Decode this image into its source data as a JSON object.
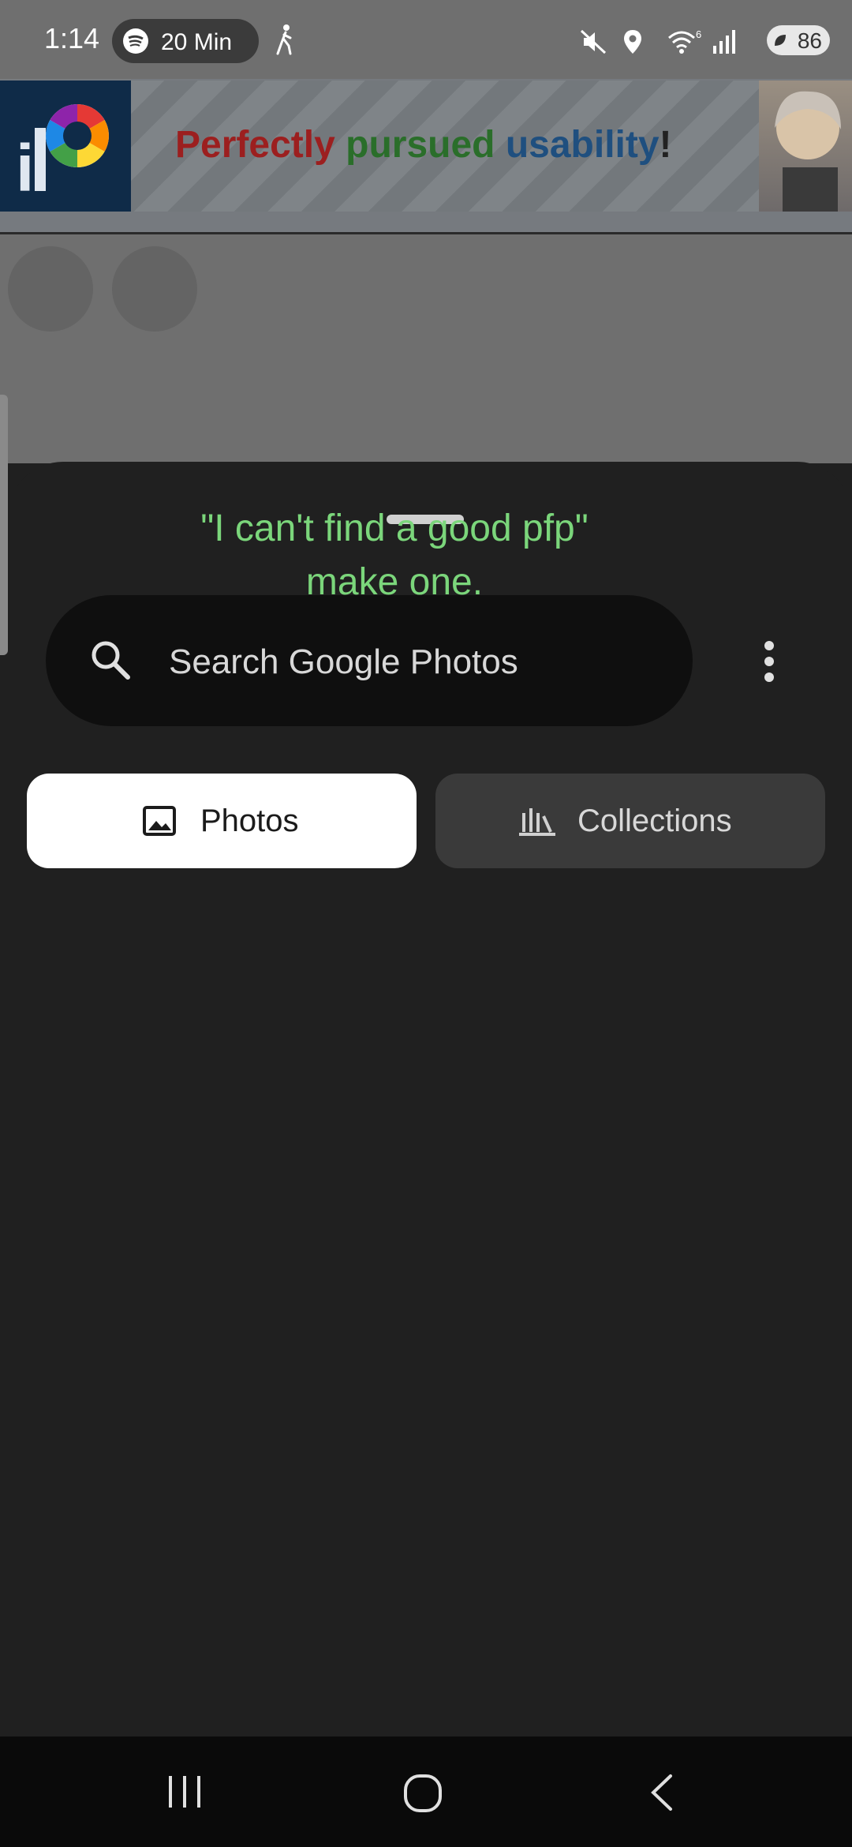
{
  "status_bar": {
    "time": "1:14",
    "spotify_label": "20 Min",
    "battery": "86",
    "icons": [
      "spotify-icon",
      "walk-icon",
      "mute-icon",
      "location-icon",
      "wifi-icon",
      "signal-icon",
      "battery-icon"
    ]
  },
  "ad": {
    "word1": "Perfectly",
    "word2": "pursued",
    "word3": "usability",
    "word4": "!",
    "colors": {
      "word1": "#9c1f1f",
      "word2": "#2a6e2a",
      "word3": "#1f4f7f"
    }
  },
  "sheet": {
    "caption_line1": "\"I can't find a good pfp\"",
    "caption_line2": "make one.",
    "search_placeholder": "Search Google Photos",
    "tabs": [
      {
        "label": "Photos",
        "selected": true,
        "icon": "image-icon"
      },
      {
        "label": "Collections",
        "selected": false,
        "icon": "collections-icon"
      }
    ]
  },
  "nav": {
    "icons": [
      "recents-icon",
      "home-icon",
      "back-icon"
    ]
  },
  "colors": {
    "caption": "#7bd67b",
    "sheet_bg": "#202020",
    "selected_tab": "#ffffff"
  }
}
